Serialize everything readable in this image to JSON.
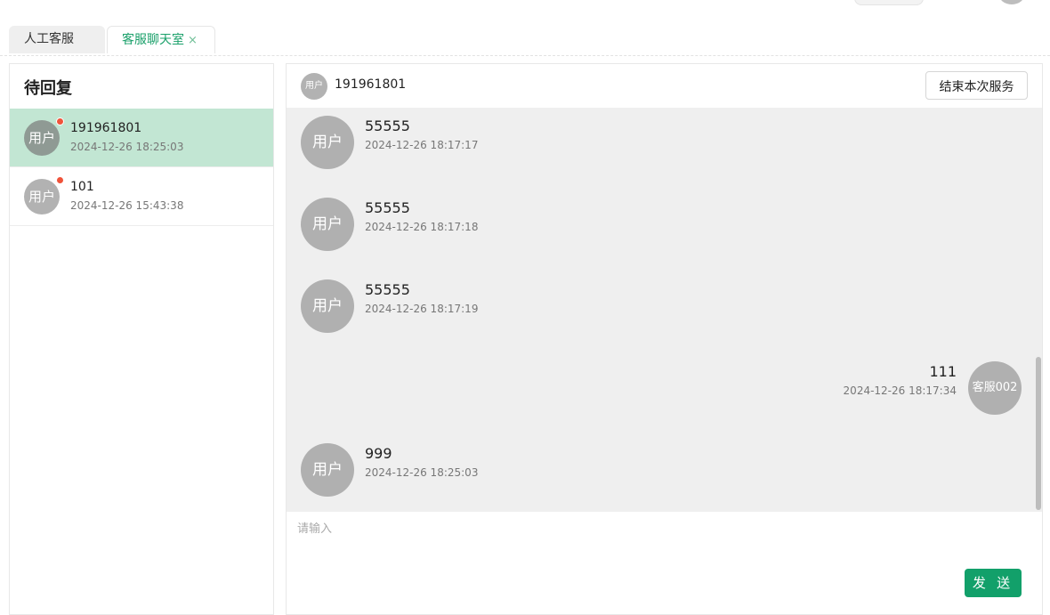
{
  "tabs": [
    {
      "label": "人工客服"
    },
    {
      "label": "客服聊天室",
      "close_icon": "×"
    }
  ],
  "sidebar": {
    "title": "待回复",
    "conversations": [
      {
        "avatar": "用户",
        "name": "191961801",
        "time": "2024-12-26 18:25:03",
        "unread": true,
        "active": true
      },
      {
        "avatar": "用户",
        "name": "101",
        "time": "2024-12-26 15:43:38",
        "unread": true,
        "active": false
      }
    ]
  },
  "chat": {
    "header": {
      "avatar": "用户",
      "name": "191961801",
      "end_button": "结束本次服务"
    },
    "messages": [
      {
        "side": "left",
        "avatar": "用户",
        "text": "55555",
        "time": "2024-12-26 18:17:17"
      },
      {
        "side": "left",
        "avatar": "用户",
        "text": "55555",
        "time": "2024-12-26 18:17:18"
      },
      {
        "side": "left",
        "avatar": "用户",
        "text": "55555",
        "time": "2024-12-26 18:17:19"
      },
      {
        "side": "right",
        "avatar": "客服002",
        "text": "111",
        "time": "2024-12-26 18:17:34"
      },
      {
        "side": "left",
        "avatar": "用户",
        "text": "999",
        "time": "2024-12-26 18:25:03"
      }
    ],
    "input": {
      "placeholder": "请输入",
      "value": ""
    },
    "send_button": "发 送"
  },
  "colors": {
    "accent": "#12a06a",
    "active_row": "#c2e6d3",
    "unread_dot": "#f0533a",
    "chat_bg": "#efefef"
  }
}
